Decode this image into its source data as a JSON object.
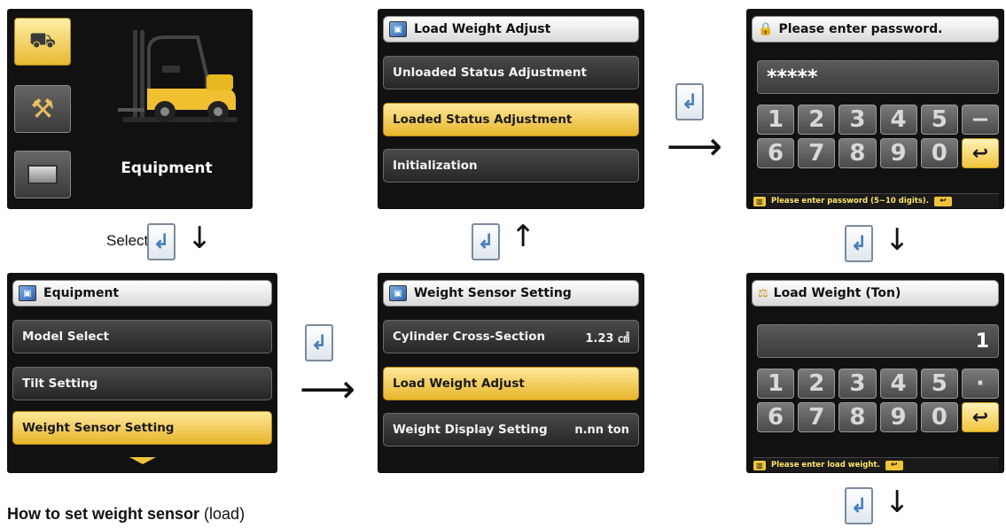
{
  "main_menu": {
    "title": "Equipment"
  },
  "flow": {
    "select_label": "Select",
    "enter_glyph": "↲",
    "down_arrow": "↓",
    "up_arrow": "↑",
    "right_arrow": "⟶"
  },
  "equipment_screen": {
    "title": "Equipment",
    "items": [
      {
        "label": "Model Select"
      },
      {
        "label": "Tilt Setting"
      },
      {
        "label": "Weight Sensor Setting"
      }
    ]
  },
  "weight_sensor_screen": {
    "title": "Weight Sensor Setting",
    "items": [
      {
        "label": "Cylinder Cross-Section",
        "value": "1.23 ㎠"
      },
      {
        "label": "Load Weight Adjust",
        "value": ""
      },
      {
        "label": "Weight Display Setting",
        "value": "n.nn ton"
      }
    ]
  },
  "load_adjust_screen": {
    "title": "Load Weight Adjust",
    "items": [
      {
        "label": "Unloaded Status Adjustment"
      },
      {
        "label": "Loaded Status Adjustment"
      },
      {
        "label": "Initialization"
      }
    ]
  },
  "password_screen": {
    "title": "Please enter password.",
    "value": "*****",
    "keys_row1": [
      "1",
      "2",
      "3",
      "4",
      "5",
      "−"
    ],
    "keys_row2": [
      "6",
      "7",
      "8",
      "9",
      "0",
      "↩"
    ],
    "hint": "Please enter password (5~10 digits)."
  },
  "load_weight_screen": {
    "title": "Load Weight (Ton)",
    "value": "1",
    "keys_row1": [
      "1",
      "2",
      "3",
      "4",
      "5",
      "·"
    ],
    "keys_row2": [
      "6",
      "7",
      "8",
      "9",
      "0",
      "↩"
    ],
    "hint": "Please enter load weight."
  },
  "caption": {
    "bold": "How to set weight sensor",
    "normal": "(load)"
  },
  "colors": {
    "selected": "#e6b52a",
    "screen_bg": "#111111"
  }
}
